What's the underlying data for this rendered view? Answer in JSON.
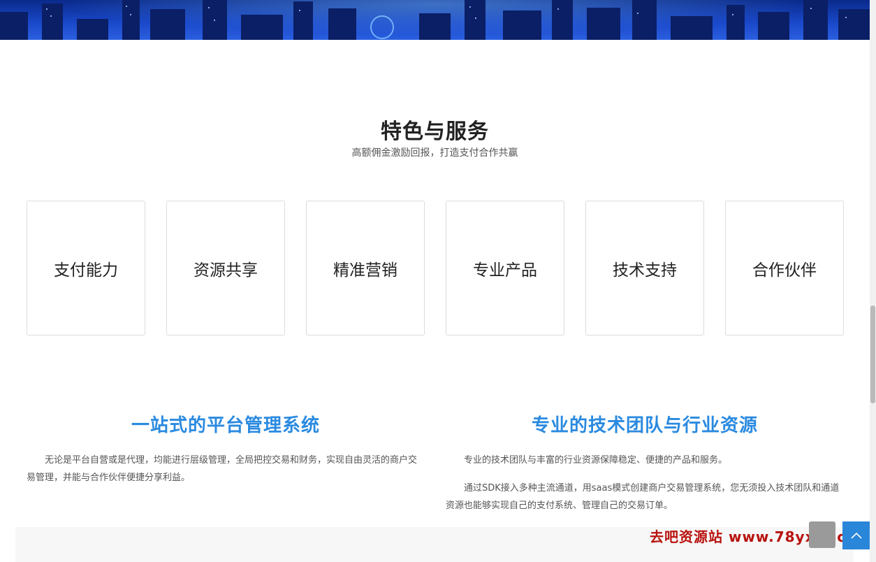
{
  "section": {
    "title": "特色与服务",
    "subtitle": "高额佣金激励回报，打造支付合作共赢"
  },
  "features": [
    {
      "label": "支付能力"
    },
    {
      "label": "资源共享"
    },
    {
      "label": "精准营销"
    },
    {
      "label": "专业产品"
    },
    {
      "label": "技术支持"
    },
    {
      "label": "合作伙伴"
    }
  ],
  "left_column": {
    "title": "一站式的平台管理系统",
    "paragraphs": [
      "无论是平台自营或是代理，均能进行层级管理，全局把控交易和财务，实现自由灵活的商户交易管理，并能与合作伙伴便捷分享利益。"
    ]
  },
  "right_column": {
    "title": "专业的技术团队与行业资源",
    "paragraphs": [
      "专业的技术团队与丰富的行业资源保障稳定、便捷的产品和服务。",
      "通过SDK接入多种主流通道，用saas模式创建商户交易管理系统，您无须投入技术团队和通道资源也能够实现自己的支付系统、管理自己的交易订单。"
    ]
  },
  "watermark": "去吧资源站 www.78yxjd.cn",
  "colors": {
    "accent": "#2a8ae0",
    "watermark": "#b8120e",
    "back_to_top": "#2a86d8"
  },
  "icons": {
    "grey_button": "blank-square-icon",
    "blue_button": "arrow-up-icon"
  }
}
